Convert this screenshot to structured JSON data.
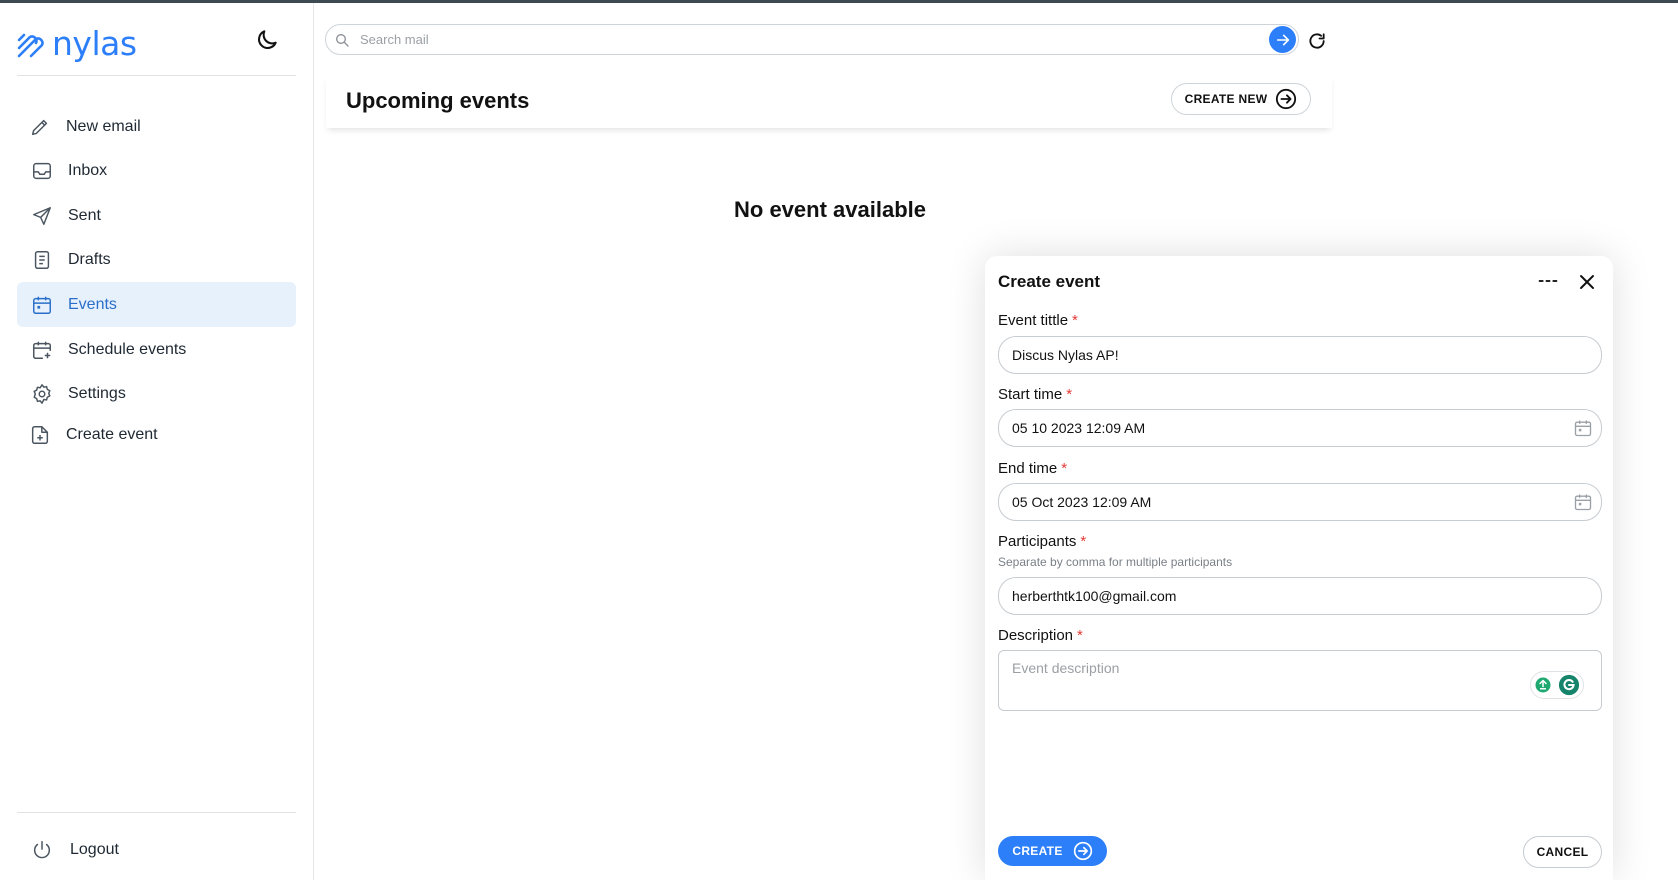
{
  "app": {
    "logo_text": "nylas",
    "accent": "#2d7ff9"
  },
  "sidebar": {
    "items": [
      {
        "label": "New email",
        "icon": "pencil-icon"
      },
      {
        "label": "Inbox",
        "icon": "inbox-icon"
      },
      {
        "label": "Sent",
        "icon": "send-icon"
      },
      {
        "label": "Drafts",
        "icon": "document-icon"
      },
      {
        "label": "Events",
        "icon": "calendar-icon",
        "active": true
      },
      {
        "label": "Schedule events",
        "icon": "calendar-plus-icon"
      },
      {
        "label": "Settings",
        "icon": "gear-icon"
      },
      {
        "label": "Create event",
        "icon": "file-plus-icon"
      }
    ],
    "logout_label": "Logout"
  },
  "search": {
    "placeholder": "Search mail"
  },
  "events": {
    "title": "Upcoming events",
    "create_new_label": "CREATE NEW",
    "empty_text": "No event available"
  },
  "modal": {
    "title": "Create event",
    "fields": {
      "event_title": {
        "label": "Event tittle",
        "value": "Discus Nylas AP!"
      },
      "start_time": {
        "label": "Start time",
        "value": "05 10 2023 12:09 AM"
      },
      "end_time": {
        "label": "End time",
        "value": "05 Oct 2023 12:09 AM"
      },
      "participants": {
        "label": "Participants",
        "hint": "Separate by comma for multiple participants",
        "value": "herberthtk100@gmail.com"
      },
      "description": {
        "label": "Description",
        "placeholder": "Event description"
      }
    },
    "required_mark": "*",
    "create_label": "CREATE",
    "cancel_label": "CANCEL"
  }
}
